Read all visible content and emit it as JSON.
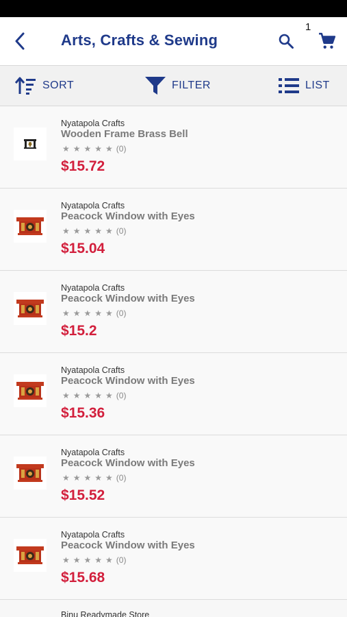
{
  "header": {
    "title": "Arts, Crafts & Sewing",
    "cart_count": "1"
  },
  "toolbar": {
    "sort_label": "SORT",
    "filter_label": "FILTER",
    "list_label": "LIST"
  },
  "colors": {
    "brand": "#1f3a8a",
    "price": "#d21f3c"
  },
  "icons": [
    "back-icon",
    "search-icon",
    "cart-icon",
    "sort-icon",
    "filter-icon",
    "list-icon",
    "star-icon"
  ],
  "products": [
    {
      "seller": "Nyatapola Crafts",
      "name": "Wooden Frame Brass Bell",
      "stars": "★★★★★",
      "rating_count": "(0)",
      "price": "$15.72",
      "thumb": "bell"
    },
    {
      "seller": "Nyatapola Crafts",
      "name": "Peacock Window with Eyes",
      "stars": "★★★★★",
      "rating_count": "(0)",
      "price": "$15.04",
      "thumb": "window"
    },
    {
      "seller": "Nyatapola Crafts",
      "name": "Peacock Window with Eyes",
      "stars": "★★★★★",
      "rating_count": "(0)",
      "price": "$15.2",
      "thumb": "window"
    },
    {
      "seller": "Nyatapola Crafts",
      "name": "Peacock Window with Eyes",
      "stars": "★★★★★",
      "rating_count": "(0)",
      "price": "$15.36",
      "thumb": "window"
    },
    {
      "seller": "Nyatapola Crafts",
      "name": "Peacock Window with Eyes",
      "stars": "★★★★★",
      "rating_count": "(0)",
      "price": "$15.52",
      "thumb": "window"
    },
    {
      "seller": "Nyatapola Crafts",
      "name": "Peacock Window with Eyes",
      "stars": "★★★★★",
      "rating_count": "(0)",
      "price": "$15.68",
      "thumb": "window"
    }
  ],
  "partial_item": {
    "seller": "Binu Readymade Store"
  }
}
